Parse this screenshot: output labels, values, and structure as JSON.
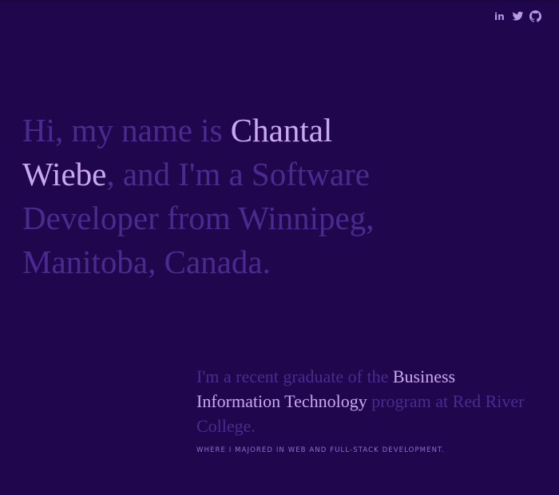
{
  "social": {
    "linkedin_label": "in",
    "accent_color": "#b89be8",
    "icons": [
      "linkedin-icon",
      "twitter-icon",
      "github-icon"
    ]
  },
  "intro": {
    "part1": "Hi, my name is ",
    "name_line1": "Chantal",
    "name_line2": "Wiebe",
    "part2": ", and I'm a Software Developer from Winnipeg, Manitoba, Canada."
  },
  "about": {
    "part1": "I'm a recent graduate of the ",
    "program": "Business Information Technology",
    "part2": " program at Red River College."
  },
  "caption": "WHERE I MAJORED IN WEB AND FULL-STACK DEVELOPMENT.",
  "colors": {
    "background": "#20074d",
    "muted_text": "#4b2a8f",
    "highlight_text": "#c9a8f2",
    "caption_text": "#8c6fd0"
  }
}
